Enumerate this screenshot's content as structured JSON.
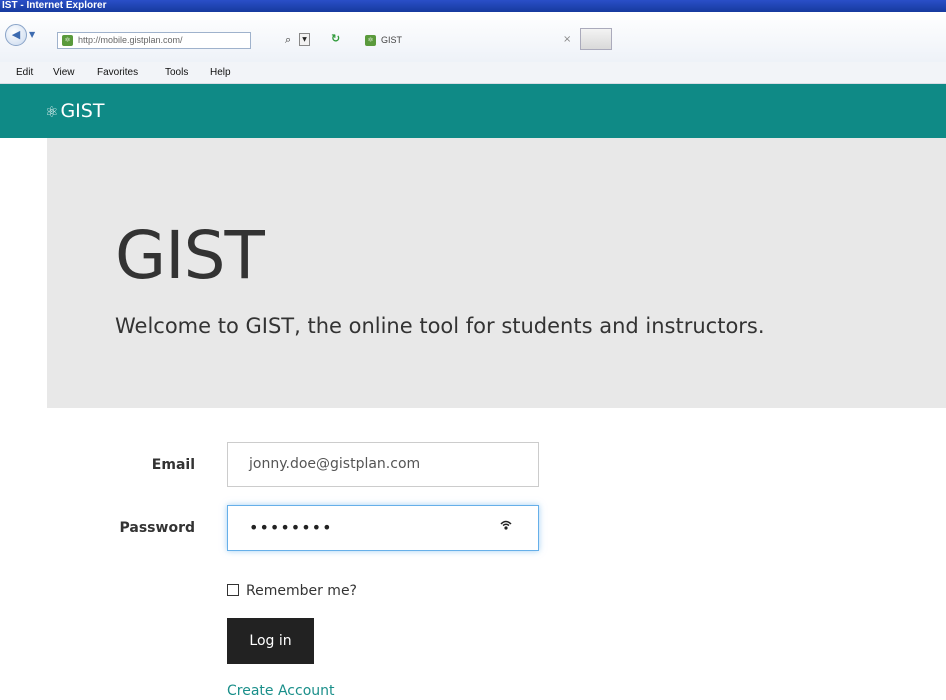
{
  "window": {
    "title": "IST - Internet Explorer"
  },
  "browser": {
    "address": "http://mobile.gistplan.com/",
    "tab_title": "GIST",
    "tab_close": "×",
    "icons": {
      "back": "back-arrow-icon",
      "forward": "forward-dropdown-icon",
      "search": "search-icon",
      "refresh": "refresh-icon",
      "favicon": "gist-favicon-icon"
    }
  },
  "menubar": {
    "items": [
      "Edit",
      "View",
      "Favorites",
      "Tools",
      "Help"
    ]
  },
  "site": {
    "brand_icon": "⚛",
    "brand_name": "GIST",
    "header_color": "#0f8a86"
  },
  "jumbotron": {
    "title": "GIST",
    "lead": "Welcome to GIST, the online tool for students and instructors."
  },
  "login_form": {
    "email_label": "Email",
    "email_value": "jonny.doe@gistplan.com",
    "password_label": "Password",
    "password_value": "••••••••",
    "remember_label": "Remember me?",
    "remember_checked": false,
    "submit_label": "Log in",
    "create_account_label": "Create Account",
    "link_color": "#1a8f8a",
    "focus_color": "#66afe9"
  }
}
